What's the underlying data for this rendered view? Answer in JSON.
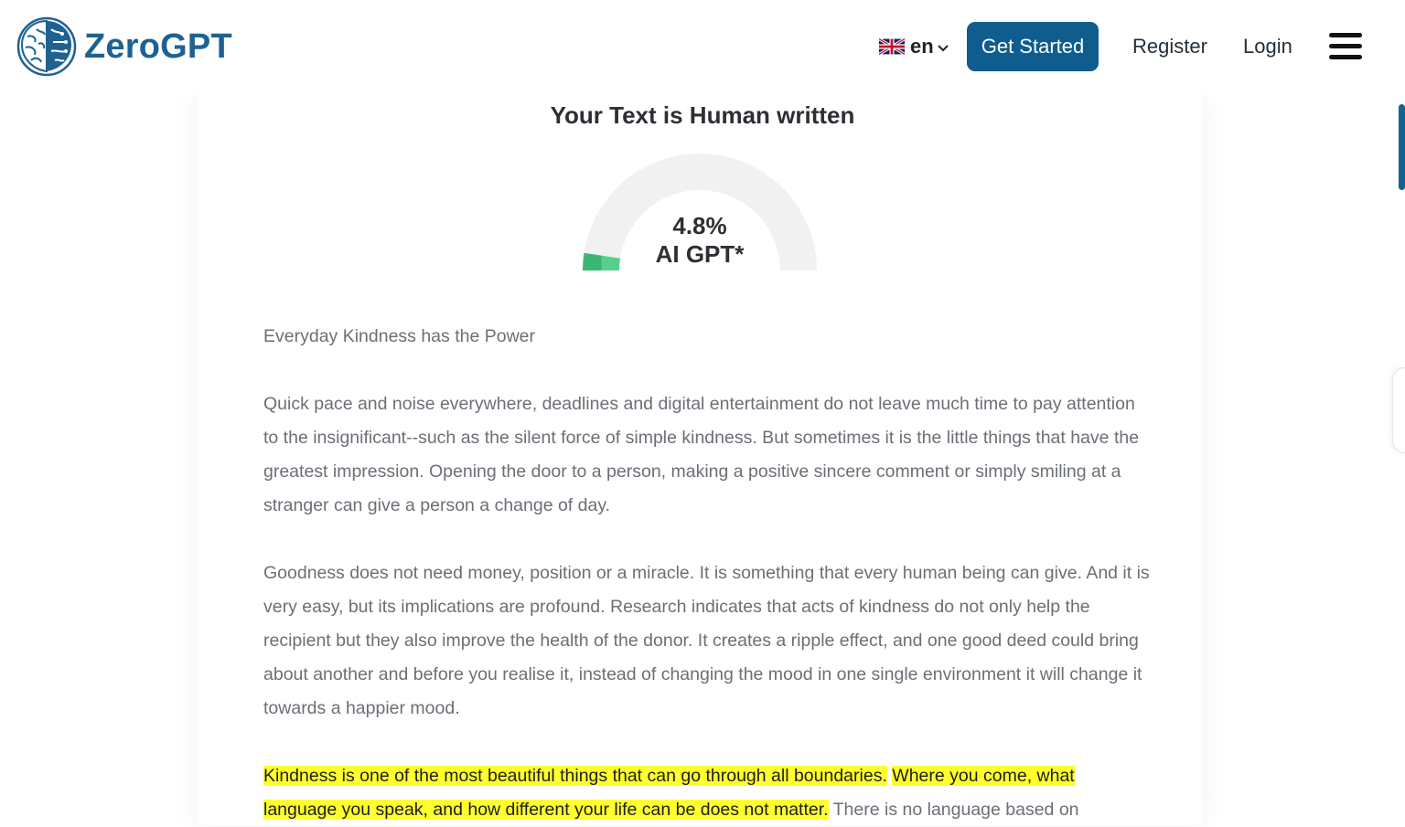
{
  "brand": {
    "name": "ZeroGPT",
    "color": "#1e6293"
  },
  "header": {
    "language_code": "en",
    "get_started_label": "Get Started",
    "register_label": "Register",
    "login_label": "Login",
    "accent_color": "#0f5d8f"
  },
  "result": {
    "title": "Your Text is Human written",
    "percent_text": "4.8%",
    "percent_value": 4.8,
    "label": "AI GPT*"
  },
  "document": {
    "title": "Everyday Kindness has the Power",
    "paragraph1": "Quick pace and noise everywhere, deadlines and digital entertainment do not leave much time to pay attention to the insignificant--such as the silent force of simple kindness. But sometimes it is the little things that have the greatest impression. Opening the door to a person, making a positive sincere comment or simply smiling at a stranger can give a person a change of day.",
    "paragraph2": "Goodness does not need money, position or a miracle. It is something that every human being can give. And it is very easy, but its implications are profound. Research indicates that acts of kindness do not only help the recipient but they also improve the health of the donor. It creates a ripple effect, and one good deed could bring about another and before you realise it, instead of changing the mood in one single environment it will change it towards a happier mood.",
    "highlight1": "Kindness is one of the most beautiful things that can go through all boundaries.",
    "highlight2": "Where you come, what language you speak, and how different your life can be does not matter.",
    "paragraph3_tail": "There is no language based on",
    "highlight_color": "#ffff2e"
  }
}
